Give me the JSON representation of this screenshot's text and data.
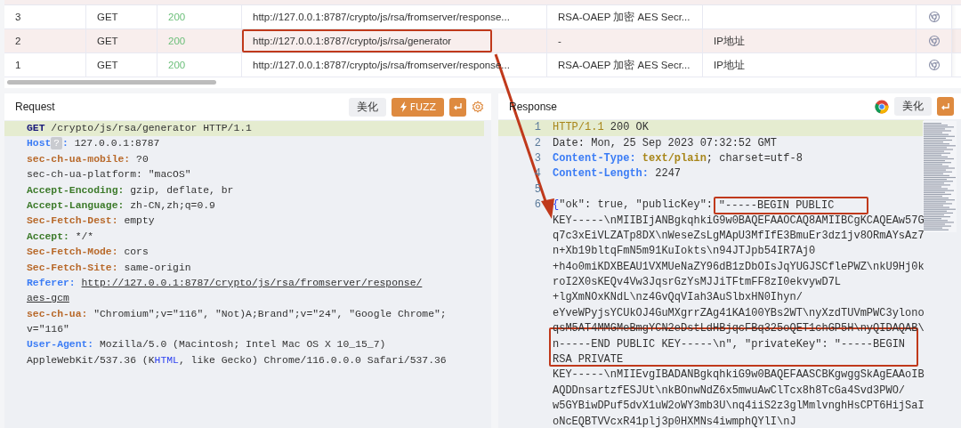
{
  "requests_table": {
    "rows": [
      {
        "id": "3",
        "method": "GET",
        "status": "200",
        "url": "http://127.0.0.1:8787/crypto/js/rsa/fromserver/response...",
        "title": "RSA-OAEP 加密 AES Secr...",
        "selected": false
      },
      {
        "id": "2",
        "method": "GET",
        "status": "200",
        "url": "http://127.0.0.1:8787/crypto/js/rsa/generator",
        "title": "-",
        "column_6": "IP地址",
        "selected": true
      },
      {
        "id": "1",
        "method": "GET",
        "status": "200",
        "url": "http://127.0.0.1:8787/crypto/js/rsa/fromserver/response...",
        "title": "RSA-OAEP 加密 AES Secr...",
        "column_6": "IP地址",
        "selected": false
      }
    ]
  },
  "request": {
    "title": "Request",
    "beautify_label": "美化",
    "fuzz_label": "FUZZ",
    "lines": [
      {
        "highlighted": true,
        "rows": [
          [
            {
              "text": "GET",
              "kind": "method"
            },
            {
              "text": " /crypto/js/rsa/generator HTTP/1.1",
              "kind": "plain"
            }
          ]
        ]
      },
      {
        "highlighted": false,
        "badge": "?",
        "rows": [
          [
            {
              "text": "Host",
              "kind": "key_blue"
            },
            {
              "text": ": ",
              "kind": "key_blue"
            },
            {
              "text": "127.0.0.1:8787",
              "kind": "plain"
            }
          ]
        ]
      },
      {
        "highlighted": false,
        "rows": [
          [
            {
              "text": "sec-ch-ua-mobile:",
              "kind": "key_warm"
            },
            {
              "text": " ?0",
              "kind": "plain"
            }
          ]
        ]
      },
      {
        "highlighted": false,
        "rows": [
          [
            {
              "text": "sec-ch-ua-platform: \"macOS\"",
              "kind": "plain"
            }
          ]
        ]
      },
      {
        "highlighted": false,
        "rows": [
          [
            {
              "text": "Accept-Encoding:",
              "kind": "key_green"
            },
            {
              "text": " gzip, deflate, br",
              "kind": "plain"
            }
          ]
        ]
      },
      {
        "highlighted": false,
        "rows": [
          [
            {
              "text": "Accept-Language:",
              "kind": "key_green"
            },
            {
              "text": " zh-CN,zh;q=0.9",
              "kind": "plain"
            }
          ]
        ]
      },
      {
        "highlighted": false,
        "rows": [
          [
            {
              "text": "Sec-Fetch-Dest:",
              "kind": "key_warm"
            },
            {
              "text": " empty",
              "kind": "plain"
            }
          ]
        ]
      },
      {
        "highlighted": false,
        "rows": [
          [
            {
              "text": "Accept:",
              "kind": "key_green"
            },
            {
              "text": " */*",
              "kind": "plain"
            }
          ]
        ]
      },
      {
        "highlighted": false,
        "rows": [
          [
            {
              "text": "Sec-Fetch-Mode:",
              "kind": "key_warm"
            },
            {
              "text": " cors",
              "kind": "plain"
            }
          ]
        ]
      },
      {
        "highlighted": false,
        "rows": [
          [
            {
              "text": "Sec-Fetch-Site:",
              "kind": "key_warm"
            },
            {
              "text": " same-origin",
              "kind": "plain"
            }
          ]
        ]
      },
      {
        "highlighted": false,
        "rows": [
          [
            {
              "text": "Referer:",
              "kind": "key_blue"
            },
            {
              "text": " ",
              "kind": "plain"
            },
            {
              "text": "http://127.0.0.1:8787/crypto/js/rsa/fromserver/response/",
              "kind": "link"
            }
          ],
          [
            {
              "text": "aes-gcm",
              "kind": "link"
            }
          ]
        ]
      },
      {
        "highlighted": false,
        "rows": [
          [
            {
              "text": "sec-ch-ua:",
              "kind": "key_warm"
            },
            {
              "text": " \"Chromium\";v=\"116\", \"Not)A;Brand\";v=\"24\", \"Google Chrome\";",
              "kind": "plain"
            }
          ],
          [
            {
              "text": "v=\"116\"",
              "kind": "plain"
            }
          ]
        ]
      },
      {
        "highlighted": false,
        "rows": [
          [
            {
              "text": "User-Agent:",
              "kind": "key_blue"
            },
            {
              "text": " Mozilla/5.0 (Macintosh; Intel Mac OS X 10_15_7)",
              "kind": "plain"
            }
          ],
          [
            {
              "text": "AppleWebKit/537.36 (K",
              "kind": "plain"
            },
            {
              "text": "HTML",
              "kind": "match"
            },
            {
              "text": ", like Gecko) Chrome/116.0.0.0 Safari/537.36",
              "kind": "plain"
            }
          ]
        ]
      }
    ]
  },
  "response": {
    "title": "Response",
    "beautify_label": "美化",
    "lines": [
      {
        "number": "1",
        "highlighted": true,
        "rows": [
          [
            {
              "text": "HTTP/1.1",
              "kind": "protocol"
            },
            {
              "text": " 200 OK",
              "kind": "plain"
            }
          ]
        ]
      },
      {
        "number": "2",
        "highlighted": false,
        "rows": [
          [
            {
              "text": "Date: Mon, 25 Sep 2023 07:32:52 GMT",
              "kind": "plain"
            }
          ]
        ]
      },
      {
        "number": "3",
        "highlighted": false,
        "rows": [
          [
            {
              "text": "Content-Type:",
              "kind": "key_blue"
            },
            {
              "text": " ",
              "kind": "plain"
            },
            {
              "text": "text/plain",
              "kind": "mime"
            },
            {
              "text": "; charset=utf-8",
              "kind": "plain"
            }
          ]
        ]
      },
      {
        "number": "4",
        "highlighted": false,
        "rows": [
          [
            {
              "text": "Content-Length:",
              "kind": "key_blue"
            },
            {
              "text": " 2247",
              "kind": "plain"
            }
          ]
        ]
      },
      {
        "number": "5",
        "highlighted": false
      },
      {
        "number": "6",
        "highlighted": false,
        "rows": [
          [
            {
              "text": "{",
              "kind": "match"
            },
            {
              "text": "\"ok\": true, \"publicKey\": ",
              "kind": "plain"
            },
            {
              "text": "\"-----BEGIN PUBLIC",
              "kind": "plain",
              "boxed": true
            }
          ],
          [
            {
              "text": "KEY-----\\nMIIBIjANBgkqhkiG9w0BAQEFAAOCAQ8AMIIBCgKCAQEAw57G",
              "kind": "plain"
            }
          ],
          [
            {
              "text": "q7c3xEiVLZATp8DX\\nWeseZsLgMApU3MfIfE3BmuEr3dz1jv8ORmAYsAz7",
              "kind": "plain"
            }
          ],
          [
            {
              "text": "n+Xb19bltqFmN5m91KuIokts\\n94JTJpb54IR7Aj0",
              "kind": "plain"
            }
          ],
          [
            {
              "text": "+h4o0miKDXBEAU1VXMUeNaZY96dB1zDbOIsJqYUGJSCflePWZ\\nkU9Hj0k",
              "kind": "plain"
            }
          ],
          [
            {
              "text": "roI2X0sKEQv4Vw3JqsrGzYsMJJiTFtmFF8zI0ekvywD7L",
              "kind": "plain"
            }
          ],
          [
            {
              "text": "+lgXmNOxKNdL\\nz4GvQqVIah3AuSlbxHN0Ihyn/",
              "kind": "plain"
            }
          ],
          [
            {
              "text": "eYveWPyjsYCUkOJ4GuMXgrrZAg41KA100YBs2WT\\nyXzdTUVmPWC3ylono",
              "kind": "plain"
            }
          ],
          [
            {
              "text": "qsM5AT4MMGMeBmgYCN2eDstLdHBjqcFBq325oQET1chGP5H\\nyQIDAQAB\\",
              "kind": "plain"
            }
          ],
          [
            {
              "text": "n-----END PUBLIC KEY-----\\n\", \"privateKey\": \"-----BEGIN",
              "kind": "plain"
            }
          ],
          [
            {
              "text": "RSA PRIVATE",
              "kind": "plain"
            }
          ],
          [
            {
              "text": "KEY-----\\nMIIEvgIBADANBgkqhkiG9w0BAQEFAASCBKgwggSkAgEAAoIB",
              "kind": "plain"
            }
          ],
          [
            {
              "text": "AQDDnsartzfESJUt\\nkBOnwNdZ6x5mwuAwClTcx8h8TcGa4Svd3PWO/",
              "kind": "plain"
            }
          ],
          [
            {
              "text": "w5GYBiwDPuf5dvX1uW2oWY3mb3U\\nq4iiS2z3glMmlvnghHsCPT6HijSaI",
              "kind": "plain"
            }
          ],
          [
            {
              "text": "oNcEQBTVVcxR41plj3p0HXMNs4iwmphQYlI\\nJ",
              "kind": "plain"
            }
          ]
        ]
      }
    ]
  }
}
